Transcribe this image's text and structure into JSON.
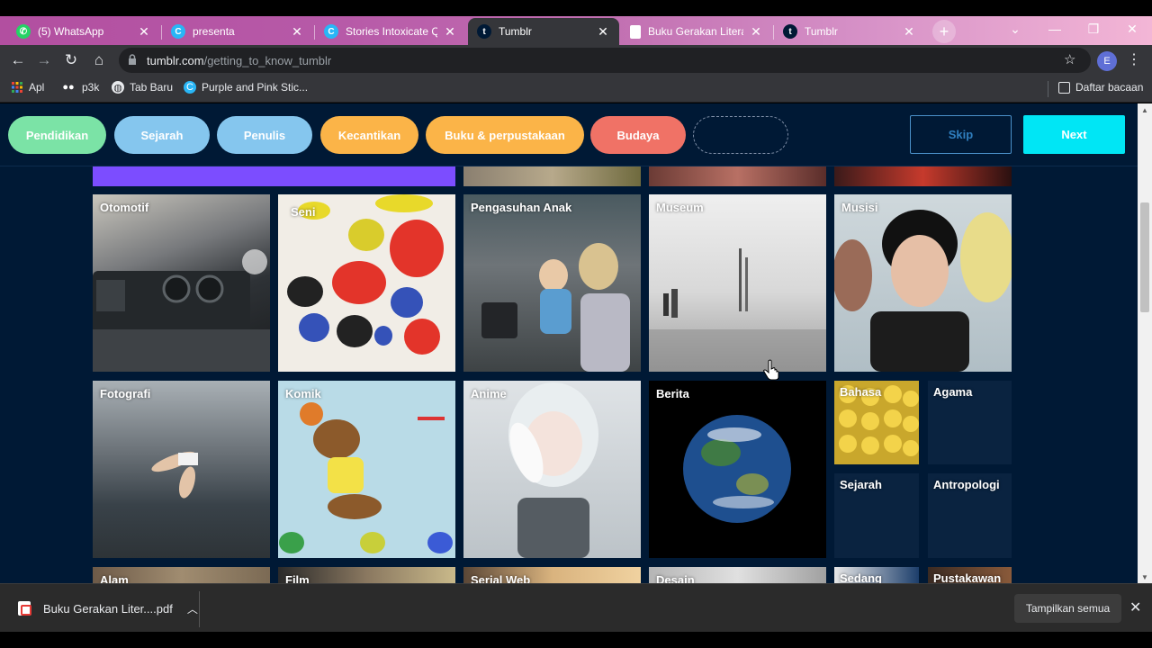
{
  "browser": {
    "tabs": [
      {
        "title": "(5) WhatsApp",
        "icon": "whatsapp-icon",
        "active": false
      },
      {
        "title": "presenta",
        "icon": "canva-icon",
        "active": false
      },
      {
        "title": "Stories Intoxicate Quo",
        "icon": "canva-icon",
        "active": false
      },
      {
        "title": "Tumblr",
        "icon": "tumblr-icon",
        "active": true
      },
      {
        "title": "Buku Gerakan Literasi",
        "icon": "document-icon",
        "active": false
      },
      {
        "title": "Tumblr",
        "icon": "tumblr-icon",
        "active": false
      }
    ],
    "url_host": "tumblr.com",
    "url_path": "/getting_to_know_tumblr",
    "profile_initial": "E",
    "bookmarks": [
      {
        "label": "Apl",
        "icon": "apps-grid-icon"
      },
      {
        "label": "p3k",
        "icon": "mask-icon"
      },
      {
        "label": "Tab Baru",
        "icon": "globe-icon"
      },
      {
        "label": "Purple and Pink Stic...",
        "icon": "canva-icon"
      }
    ],
    "reading_list": "Daftar bacaan"
  },
  "topbar": {
    "pills": [
      {
        "label": "Pendidikan",
        "color": "#7be3a6"
      },
      {
        "label": "Sejarah",
        "color": "#85c6ee"
      },
      {
        "label": "Penulis",
        "color": "#85c6ee"
      },
      {
        "label": "Kecantikan",
        "color": "#fbb448"
      },
      {
        "label": "Buku & perpustakaan",
        "color": "#fbb448"
      },
      {
        "label": "Budaya",
        "color": "#f07266"
      },
      {
        "label": "",
        "color": "transparent"
      }
    ],
    "skip_label": "Skip",
    "next_label": "Next"
  },
  "tiles": {
    "row1": [
      "Otomotif",
      "Seni",
      "Pengasuhan Anak",
      "Museum",
      "Musisi"
    ],
    "row2_large": [
      "Fotografi",
      "Komik",
      "Anime",
      "Berita"
    ],
    "row2_small": [
      "Bahasa",
      "Agama",
      "Sejarah",
      "Antropologi"
    ],
    "row3": [
      "Alam",
      "Film",
      "Serial Web",
      "Desain",
      "Sedang",
      "Pustakawan"
    ]
  },
  "downloads": {
    "file_name": "Buku Gerakan Liter....pdf",
    "show_all": "Tampilkan semua"
  },
  "colors": {
    "page_bg": "#001935",
    "accent_next": "#00e6f5",
    "purple_banner": "#7c4dff"
  }
}
